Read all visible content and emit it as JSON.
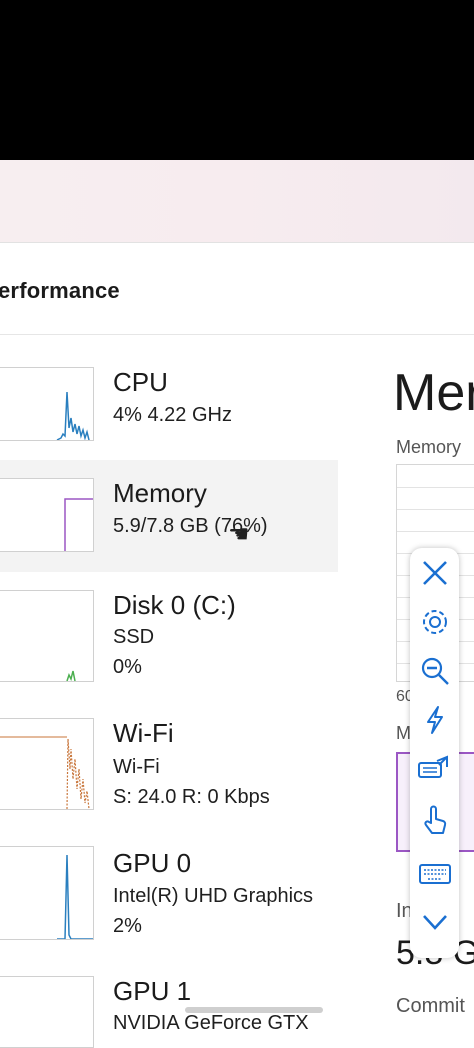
{
  "header": {
    "title": "erformance"
  },
  "sidebar": {
    "items": [
      {
        "name": "CPU",
        "line1": "4%  4.22 GHz",
        "line2": ""
      },
      {
        "name": "Memory",
        "line1": "5.9/7.8 GB (76%)",
        "line2": ""
      },
      {
        "name": "Disk 0 (C:)",
        "line1": "SSD",
        "line2": "0%"
      },
      {
        "name": "Wi-Fi",
        "line1": "Wi-Fi",
        "line2": "S: 24.0  R: 0 Kbps"
      },
      {
        "name": "GPU 0",
        "line1": "Intel(R) UHD Graphics",
        "line2": "2%"
      },
      {
        "name": "GPU 1",
        "line1": "NVIDIA GeForce GTX",
        "line2": ""
      }
    ]
  },
  "main": {
    "title": "Mer",
    "graph_label": "Memory",
    "tick_60": "60",
    "composition_label": "M",
    "in_use_label": "In",
    "in_use_value": "5.8 G",
    "commit_label": "Commit"
  },
  "toolbar": {
    "icons": [
      "close-icon",
      "settings-icon",
      "zoom-out-icon",
      "lightning-icon",
      "keyboard-share-icon",
      "touch-icon",
      "keyboard-icon",
      "chevron-down-icon"
    ]
  },
  "colors": {
    "accent_purple": "#9b57c4",
    "cpu_blue": "#2a7fbf",
    "disk_green": "#4caf50",
    "wifi_orange": "#c8753a",
    "toolbar_icon": "#1a6fd1"
  }
}
